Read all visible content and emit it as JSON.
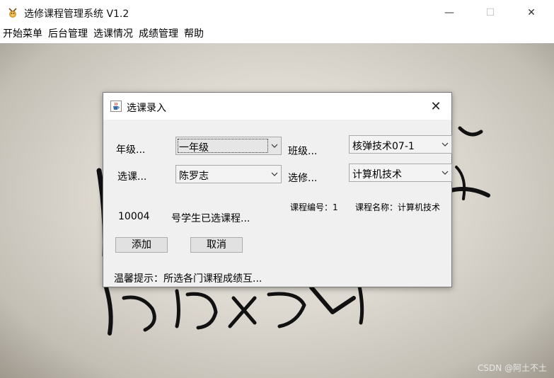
{
  "window": {
    "title": "选修课程管理系统 V1.2",
    "min_glyph": "—",
    "max_glyph": "☐",
    "close_glyph": "✕"
  },
  "menu": [
    "开始菜单",
    "后台管理",
    "选课情况",
    "成绩管理",
    "帮助"
  ],
  "dialog": {
    "title": "选课录入",
    "close_glyph": "✕",
    "grade_label": "年级...",
    "grade_value": "一年级",
    "class_label": "班级...",
    "class_value": "核弹技术07-1",
    "select_label": "选课...",
    "student_value": "陈罗志",
    "elective_label": "选修...",
    "course_value": "计算机技术",
    "course_no_text": "课程编号：1",
    "course_name_text": "课程名称：计算机技术",
    "student_id": "10004",
    "selected_text": "号学生已选课程...",
    "add_button": "添加",
    "cancel_button": "取消",
    "tip_text": "温馨提示：所选各门课程成绩互..."
  },
  "watermark": "CSDN @阿土不土"
}
